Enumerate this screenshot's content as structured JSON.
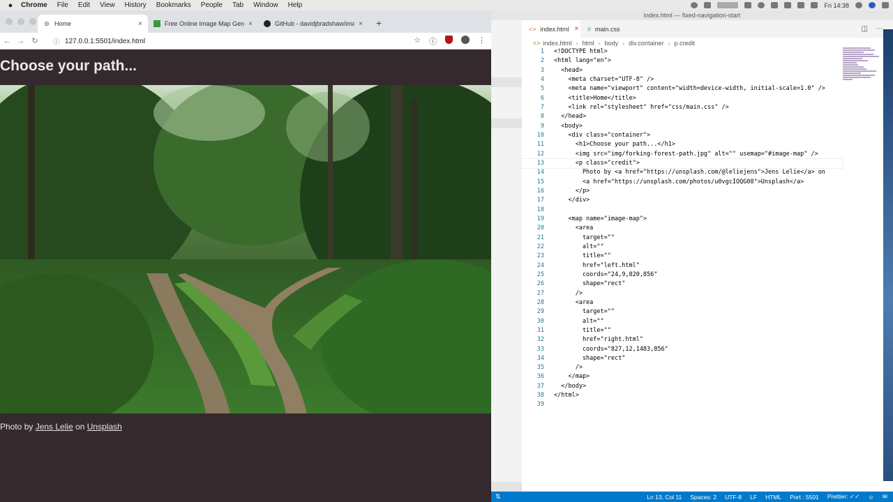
{
  "menubar": {
    "apple": "",
    "items": [
      "Chrome",
      "File",
      "Edit",
      "View",
      "History",
      "Bookmarks",
      "People",
      "Tab",
      "Window",
      "Help"
    ],
    "clock": "Fri 14:38"
  },
  "browser": {
    "tabs": [
      {
        "title": "Home",
        "favicon": "globe-icon"
      },
      {
        "title": "Free Online Image Map Genera",
        "favicon": "image-map-icon"
      },
      {
        "title": "GitHub - davidjbradshaw/imag",
        "favicon": "github-icon"
      }
    ],
    "url": "127.0.0.1:5501/index.html"
  },
  "page": {
    "heading": "Choose your path...",
    "credit_prefix": "Photo by ",
    "credit_author": "Jens Lelie",
    "credit_middle": " on ",
    "credit_site": "Unsplash"
  },
  "editor": {
    "window_title": "index.html — fixed-navigation-start",
    "tabs": [
      {
        "title": "index.html",
        "icon": "<>"
      },
      {
        "title": "main.css",
        "icon": "#"
      }
    ],
    "breadcrumb": [
      "index.html",
      "html",
      "body",
      "div.container",
      "p.credit"
    ],
    "lines": [
      "<!DOCTYPE html>",
      "<html lang=\"en\">",
      "  <head>",
      "    <meta charset=\"UTF-8\" />",
      "    <meta name=\"viewport\" content=\"width=device-width, initial-scale=1.0\" />",
      "    <title>Home</title>",
      "    <link rel=\"stylesheet\" href=\"css/main.css\" />",
      "  </head>",
      "  <body>",
      "    <div class=\"container\">",
      "      <h1>Choose your path...</h1>",
      "      <img src=\"img/forking-forest-path.jpg\" alt=\"\" usemap=\"#image-map\" />",
      "      <p class=\"credit\">",
      "        Photo by <a href=\"https://unsplash.com/@leliejens\">Jens Lelie</a> on",
      "        <a href=\"https://unsplash.com/photos/u0vgcIOQG08\">Unsplash</a>",
      "      </p>",
      "    </div>",
      "",
      "    <map name=\"image-map\">",
      "      <area",
      "        target=\"\"",
      "        alt=\"\"",
      "        title=\"\"",
      "        href=\"left.html\"",
      "        coords=\"24,9,820,856\"",
      "        shape=\"rect\"",
      "      />",
      "      <area",
      "        target=\"\"",
      "        alt=\"\"",
      "        title=\"\"",
      "        href=\"right.html\"",
      "        coords=\"827,12,1483,856\"",
      "        shape=\"rect\"",
      "      />",
      "    </map>",
      "  </body>",
      "</html>",
      ""
    ],
    "current_line": 13,
    "status": {
      "position": "Ln 13, Col 11",
      "spaces": "Spaces: 2",
      "encoding": "UTF-8",
      "eol": "LF",
      "language": "HTML",
      "port": "Port : 5501",
      "prettier": "Prettier: ✓✓"
    }
  }
}
